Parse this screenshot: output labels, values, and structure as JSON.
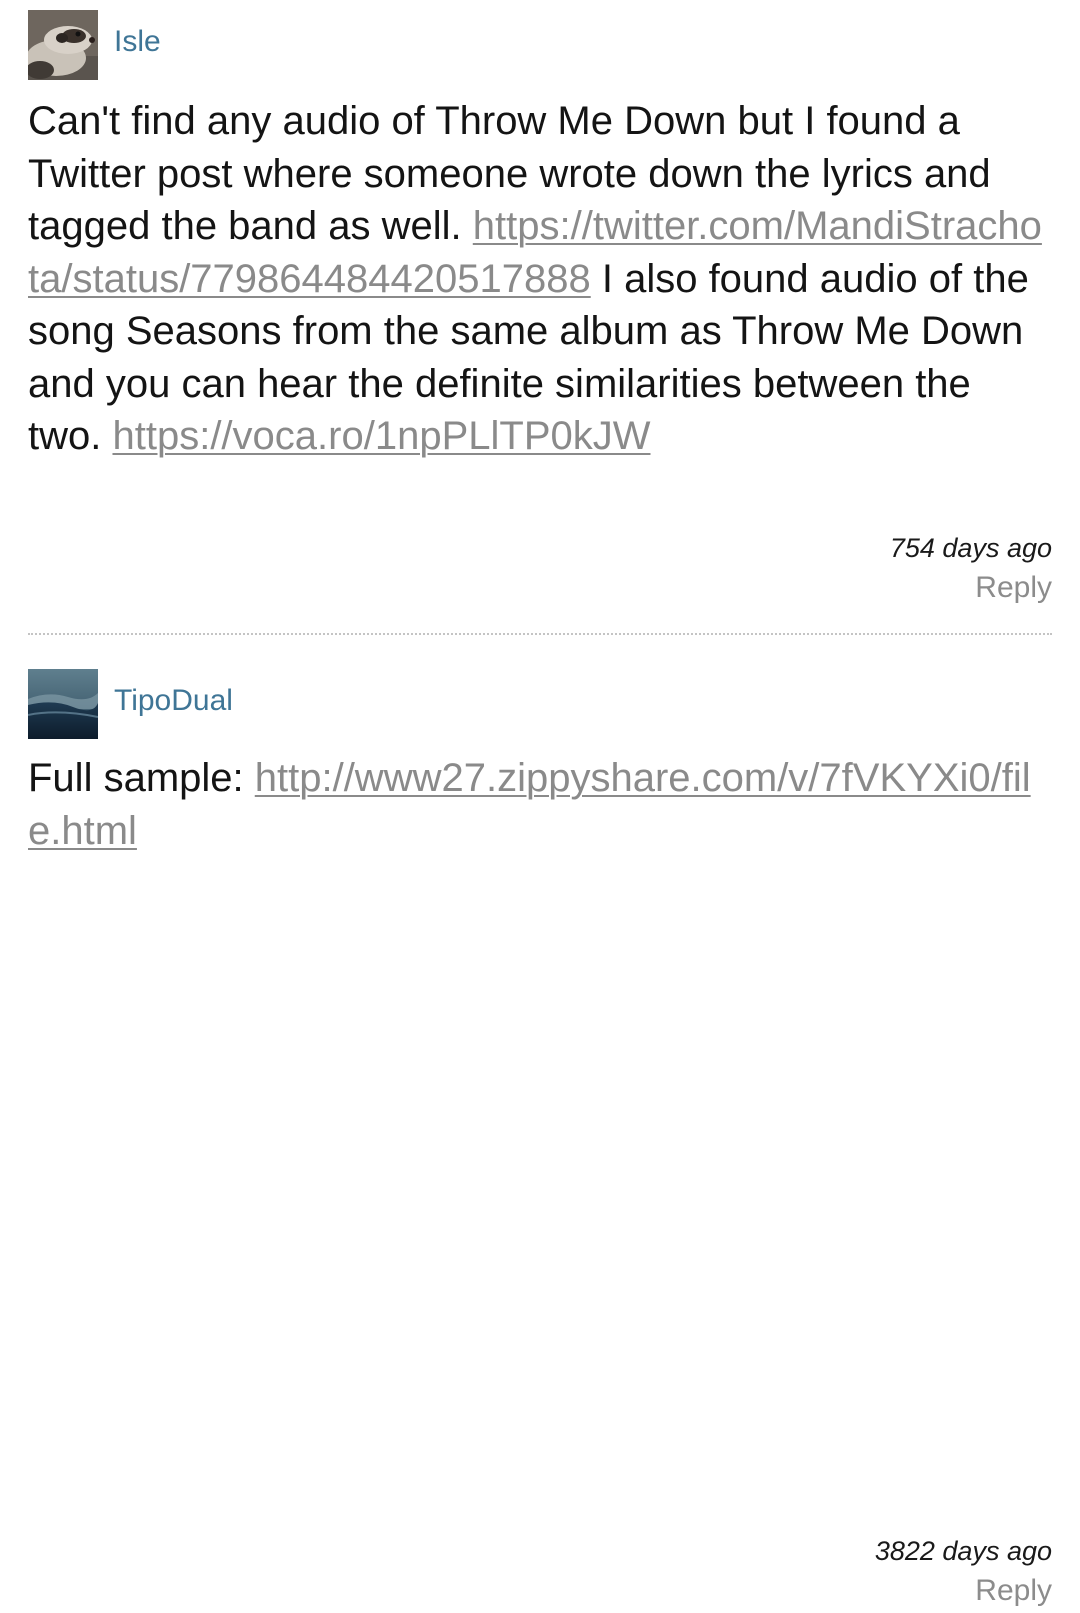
{
  "comments": [
    {
      "username": "Isle",
      "avatar_icon": "ferret-avatar",
      "text_1": "Can't find any audio of Throw Me Down but I found a Twitter post where someone wrote down the lyrics and tagged the band as well. ",
      "link_1": "https://twitter.com/MandiStrachota/status/779864484420517888",
      "text_2": " I also found audio of the song Seasons from the same album as Throw Me Down and you can hear the definite similarities between the two. ",
      "link_2": "https://voca.ro/1npPLlTP0kJW",
      "timestamp": "754 days ago",
      "reply_label": "Reply"
    },
    {
      "username": "TipoDual",
      "avatar_icon": "landscape-avatar",
      "text_1": "Full sample: ",
      "link_1": "http://www27.zippyshare.com/v/7fVKYXi0/file.html",
      "timestamp": "3822 days ago",
      "reply_label": "Reply"
    }
  ],
  "colors": {
    "username": "#3f7596",
    "link": "#8a8a8a",
    "reply": "#8c8c8c",
    "text": "#141414",
    "divider": "#c4c4c4"
  }
}
